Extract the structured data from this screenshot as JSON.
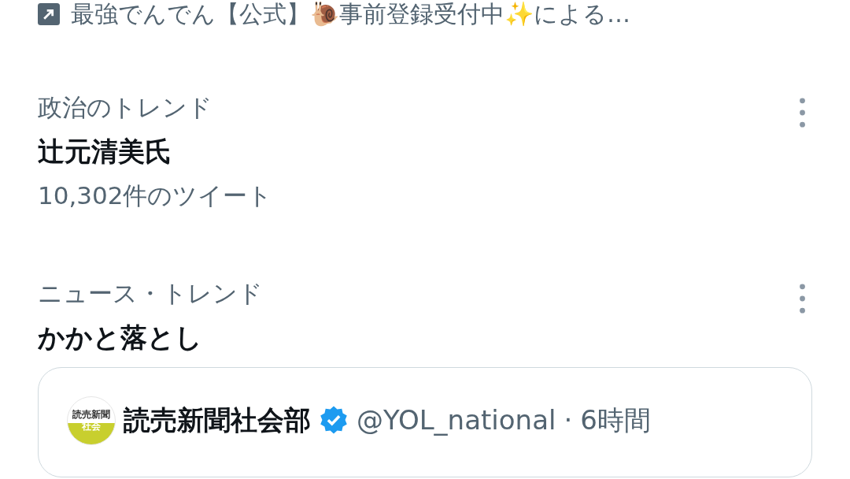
{
  "promoted": {
    "text": "最強でんでん【公式】🐌事前登録受付中✨による…"
  },
  "trends": [
    {
      "category": "政治のトレンド",
      "title": "辻元清美氏",
      "count": "10,302件のツイート"
    },
    {
      "category": "ニュース・トレンド",
      "title": "かかと落とし"
    }
  ],
  "tweet": {
    "avatar_top": "読売新聞",
    "avatar_bottom": "社会",
    "name": "読売新聞社会部",
    "verified": true,
    "handle": "@YOL_national",
    "separator": "·",
    "time": "6時間"
  }
}
